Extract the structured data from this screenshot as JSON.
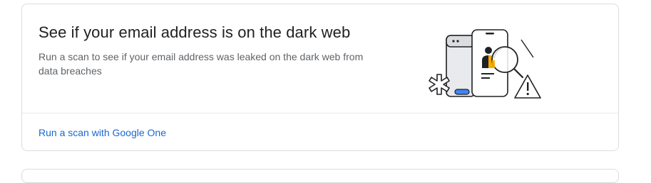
{
  "card": {
    "title": "See if your email address is on the dark web",
    "description": "Run a scan to see if your email address was leaked on the dark web from data breaches",
    "action_label": "Run a scan with Google One",
    "illustration_icon": "dark-web-scan-illustration-icon"
  },
  "colors": {
    "link": "#1967d2",
    "title": "#202124",
    "description": "#5f6368",
    "border": "#dadce0",
    "accent_yellow": "#f9ab00",
    "accent_blue": "#4285f4"
  }
}
